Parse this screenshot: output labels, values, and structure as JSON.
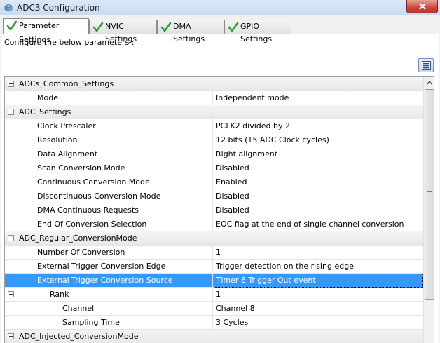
{
  "window": {
    "title": "ADC3 Configuration",
    "accent": "#3399ff"
  },
  "tabs": [
    {
      "label": "Parameter Settings",
      "active": true,
      "icon": "check-icon"
    },
    {
      "label": "NVIC Settings",
      "active": false,
      "icon": "check-icon"
    },
    {
      "label": "DMA Settings",
      "active": false,
      "icon": "check-icon"
    },
    {
      "label": "GPIO Settings",
      "active": false,
      "icon": "check-icon"
    }
  ],
  "instructions": "Configure the below parameters :",
  "tree": {
    "rows": [
      {
        "type": "group",
        "label": "ADCs_Common_Settings"
      },
      {
        "type": "param",
        "label": "Mode",
        "value": "Independent mode"
      },
      {
        "type": "group",
        "label": "ADC_Settings"
      },
      {
        "type": "param",
        "label": "Clock Prescaler",
        "value": "PCLK2 divided by 2"
      },
      {
        "type": "param",
        "label": "Resolution",
        "value": "12 bits (15 ADC Clock cycles)"
      },
      {
        "type": "param",
        "label": "Data Alignment",
        "value": "Right alignment"
      },
      {
        "type": "param",
        "label": "Scan Conversion Mode",
        "value": "Disabled"
      },
      {
        "type": "param",
        "label": "Continuous Conversion Mode",
        "value": "Enabled"
      },
      {
        "type": "param",
        "label": "Discontinuous Conversion Mode",
        "value": "Disabled"
      },
      {
        "type": "param",
        "label": "DMA Continuous Requests",
        "value": "Disabled"
      },
      {
        "type": "param",
        "label": "End Of Conversion Selection",
        "value": "EOC flag at the end of single channel conversion"
      },
      {
        "type": "group",
        "label": "ADC_Regular_ConversionMode"
      },
      {
        "type": "param",
        "label": "Number Of Conversion",
        "value": "1"
      },
      {
        "type": "param",
        "label": "External Trigger Conversion Edge",
        "value": "Trigger detection on the rising edge"
      },
      {
        "type": "param",
        "label": "External Trigger Conversion Source",
        "value": "Timer 6 Trigger Out event",
        "selected": true
      },
      {
        "type": "subgroup",
        "label": "Rank",
        "value": "1"
      },
      {
        "type": "subparam",
        "label": "Channel",
        "value": "Channel 8"
      },
      {
        "type": "subparam",
        "label": "Sampling Time",
        "value": "3 Cycles"
      },
      {
        "type": "group",
        "label": "ADC_Injected_ConversionMode"
      }
    ]
  }
}
